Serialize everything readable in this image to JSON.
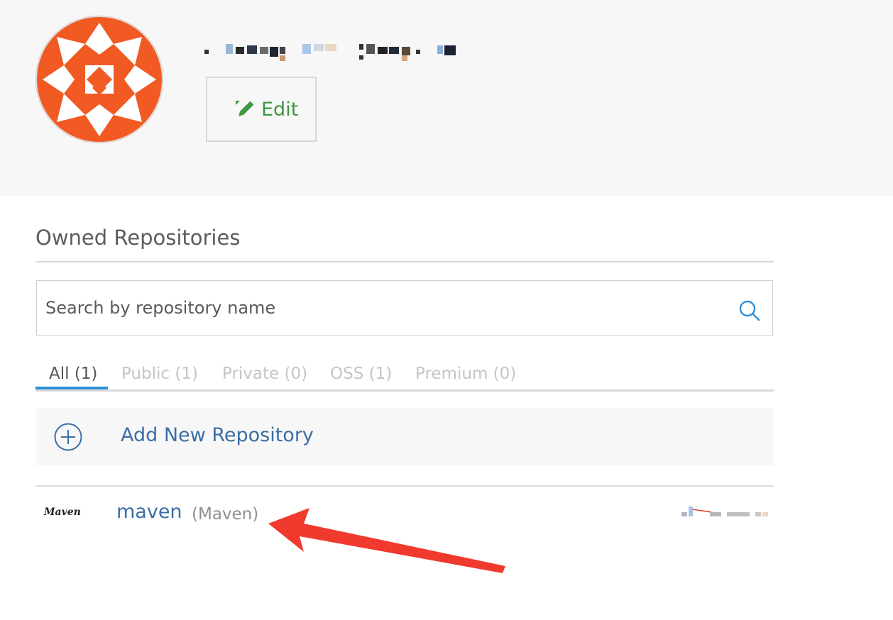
{
  "profile": {
    "edit_label": "Edit"
  },
  "owned_repositories": {
    "title": "Owned Repositories",
    "search_placeholder": "Search by repository name",
    "tabs": [
      {
        "label": "All (1)",
        "active": true
      },
      {
        "label": "Public (1)",
        "active": false
      },
      {
        "label": "Private (0)",
        "active": false
      },
      {
        "label": "OSS (1)",
        "active": false
      },
      {
        "label": "Premium (0)",
        "active": false
      }
    ],
    "add_new_label": "Add New Repository",
    "repositories": [
      {
        "logo_text": "Maven",
        "name": "maven",
        "type": "(Maven)"
      }
    ]
  },
  "colors": {
    "avatar_orange": "#f15a22",
    "edit_green": "#3f9642",
    "link_blue": "#3a6ea5",
    "active_tab_underline": "#2f8fd8",
    "annotation_red": "#f03a2e"
  },
  "icons": {
    "edit": "pencil-icon",
    "search": "search-icon",
    "add": "plus-circle-icon"
  }
}
